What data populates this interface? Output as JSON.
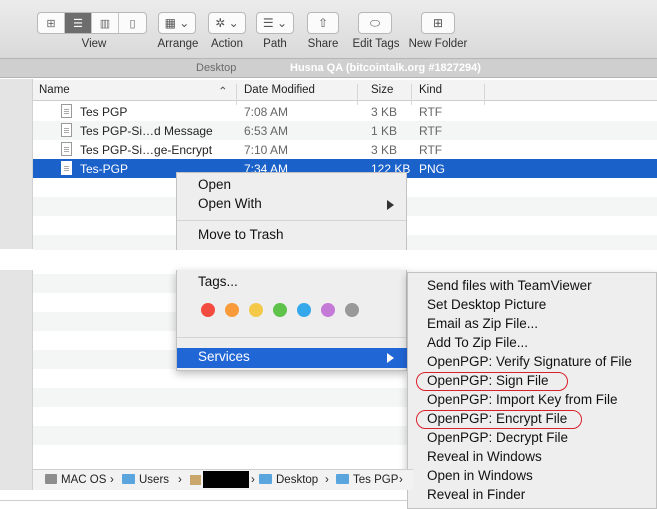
{
  "toolbar": {
    "view_label": "View",
    "arrange_label": "Arrange",
    "action_label": "Action",
    "path_label": "Path",
    "share_label": "Share",
    "edit_tags_label": "Edit Tags",
    "new_folder_label": "New Folder"
  },
  "titlebar": {
    "location": "Desktop",
    "overlay": "Husna QA (bitcointalk.org #1827294)"
  },
  "columns": {
    "name": "Name",
    "date": "Date Modified",
    "size": "Size",
    "kind": "Kind"
  },
  "files": [
    {
      "name": "Tes PGP",
      "date": "7:08 AM",
      "size": "3 KB",
      "kind": "RTF"
    },
    {
      "name": "Tes PGP-Si…d Message",
      "date": "6:53 AM",
      "size": "1 KB",
      "kind": "RTF"
    },
    {
      "name": "Tes PGP-Si…ge-Encrypt",
      "date": "7:10 AM",
      "size": "3 KB",
      "kind": "RTF"
    },
    {
      "name": "Tes-PGP",
      "date": "7:34 AM",
      "size": "122 KB",
      "kind": "PNG"
    }
  ],
  "context_menu": {
    "open": "Open",
    "open_with": "Open With",
    "move_to_trash": "Move to Trash",
    "tags": "Tags...",
    "services": "Services",
    "tag_colors": [
      "#f24b3f",
      "#f99a3b",
      "#f4c94a",
      "#5fc24b",
      "#34a8ea",
      "#c67ad8",
      "#999999"
    ]
  },
  "services_menu": [
    "Send files with TeamViewer",
    "Set Desktop Picture",
    "Email as Zip File...",
    "Add To Zip File...",
    "OpenPGP: Verify Signature of File",
    "OpenPGP: Sign File",
    "OpenPGP: Import Key from File",
    "OpenPGP: Encrypt File",
    "OpenPGP: Decrypt File",
    "Reveal in Windows",
    "Open in Windows",
    "Reveal in Finder"
  ],
  "breadcrumb": {
    "drive": "MAC OS",
    "users": "Users",
    "desktop": "Desktop",
    "folder": "Tes PGP",
    "sep": "›"
  },
  "accent": "#1a61c9",
  "highlight_oval_color": "#d9212b"
}
